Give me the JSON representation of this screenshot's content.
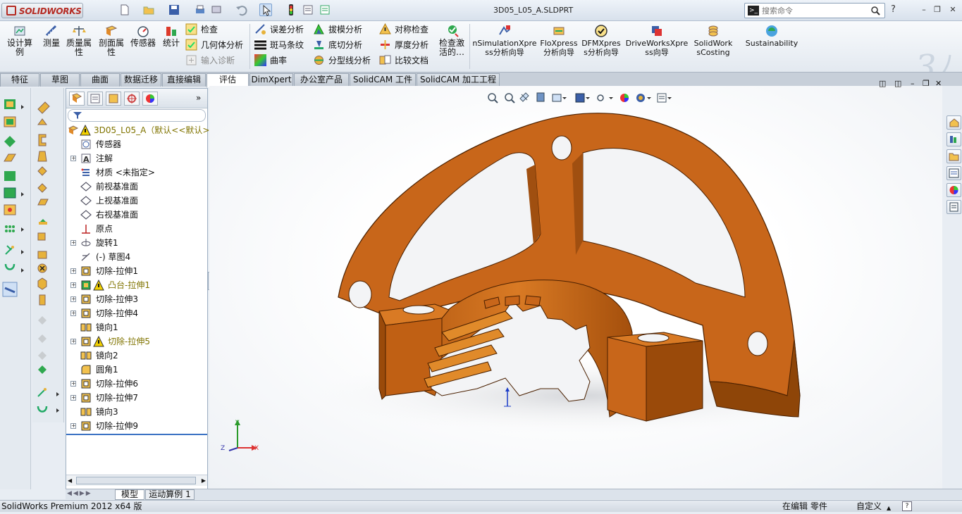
{
  "titlebar": {
    "brand": "SOLIDWORKS",
    "document_title": "3D05_L05_A.SLDPRT",
    "search_placeholder": "搜索命令",
    "help_symbol": "?"
  },
  "command_manager": {
    "big_buttons": [
      {
        "label": "设计算例",
        "icon": "design-study-icon"
      },
      {
        "label": "测量",
        "icon": "measure-icon"
      },
      {
        "label": "质量属性",
        "icon": "mass-properties-icon"
      },
      {
        "label": "剖面属性",
        "icon": "section-properties-icon"
      },
      {
        "label": "传感器",
        "icon": "sensor-icon"
      },
      {
        "label": "统计",
        "icon": "statistics-icon"
      }
    ],
    "col1": [
      {
        "label": "检查",
        "icon": "check-icon",
        "disabled": false
      },
      {
        "label": "几何体分析",
        "icon": "geometry-analysis-icon",
        "disabled": false
      },
      {
        "label": "输入诊断",
        "icon": "import-diagnostics-icon",
        "disabled": true
      }
    ],
    "col2": [
      {
        "label": "误差分析",
        "icon": "deviation-analysis-icon"
      },
      {
        "label": "斑马条纹",
        "icon": "zebra-stripes-icon"
      },
      {
        "label": "曲率",
        "icon": "curvature-icon"
      }
    ],
    "col3": [
      {
        "label": "拔模分析",
        "icon": "draft-analysis-icon"
      },
      {
        "label": "底切分析",
        "icon": "undercut-analysis-icon"
      },
      {
        "label": "分型线分析",
        "icon": "parting-line-analysis-icon"
      }
    ],
    "col4": [
      {
        "label": "对称检查",
        "icon": "symmetry-check-icon"
      },
      {
        "label": "厚度分析",
        "icon": "thickness-analysis-icon"
      },
      {
        "label": "比较文档",
        "icon": "compare-documents-icon"
      }
    ],
    "check_active": "检查激活的…",
    "xpress": [
      {
        "label": "nSimulationXpress分析向导",
        "icon": "simulationxpress-icon"
      },
      {
        "label": "FloXpress分析向导",
        "icon": "floxpress-icon"
      },
      {
        "label": "DFMXpress分析向导",
        "icon": "dfmxpress-icon"
      },
      {
        "label": "DriveWorksXpress向导",
        "icon": "driveworksxpress-icon"
      },
      {
        "label": "SolidWorksCosting",
        "icon": "costing-icon"
      },
      {
        "label": "Sustainability",
        "icon": "sustainability-icon"
      }
    ]
  },
  "tabs": [
    "特征",
    "草图",
    "曲面",
    "数据迁移",
    "直接编辑",
    "评估",
    "DimXpert",
    "办公室产品",
    "SolidCAM 工件",
    "SolidCAM 加工工程"
  ],
  "active_tab": "评估",
  "feature_tree": {
    "root": "3D05_L05_A（默认<<默认>_",
    "items": [
      {
        "label": "传感器",
        "icon": "sensor-folder-icon",
        "expand": false,
        "warn": false
      },
      {
        "label": "注解",
        "icon": "annotations-icon",
        "expand": true,
        "warn": false
      },
      {
        "label": "材质 <未指定>",
        "icon": "material-icon",
        "expand": false,
        "warn": false
      },
      {
        "label": "前视基准面",
        "icon": "plane-icon",
        "expand": false,
        "warn": false
      },
      {
        "label": "上视基准面",
        "icon": "plane-icon",
        "expand": false,
        "warn": false
      },
      {
        "label": "右视基准面",
        "icon": "plane-icon",
        "expand": false,
        "warn": false
      },
      {
        "label": "原点",
        "icon": "origin-icon",
        "expand": false,
        "warn": false
      },
      {
        "label": "旋转1",
        "icon": "revolve-icon",
        "expand": true,
        "warn": false
      },
      {
        "label": "(-) 草图4",
        "icon": "sketch-icon",
        "expand": false,
        "warn": false
      },
      {
        "label": "切除-拉伸1",
        "icon": "cut-extrude-icon",
        "expand": true,
        "warn": false
      },
      {
        "label": "凸台-拉伸1",
        "icon": "boss-extrude-icon",
        "expand": true,
        "warn": true
      },
      {
        "label": "切除-拉伸3",
        "icon": "cut-extrude-icon",
        "expand": true,
        "warn": false
      },
      {
        "label": "切除-拉伸4",
        "icon": "cut-extrude-icon",
        "expand": true,
        "warn": false
      },
      {
        "label": "镜向1",
        "icon": "mirror-icon",
        "expand": false,
        "warn": false
      },
      {
        "label": "切除-拉伸5",
        "icon": "cut-extrude-icon",
        "expand": true,
        "warn": true
      },
      {
        "label": "镜向2",
        "icon": "mirror-icon",
        "expand": false,
        "warn": false
      },
      {
        "label": "圆角1",
        "icon": "fillet-icon",
        "expand": false,
        "warn": false
      },
      {
        "label": "切除-拉伸6",
        "icon": "cut-extrude-icon",
        "expand": true,
        "warn": false
      },
      {
        "label": "切除-拉伸7",
        "icon": "cut-extrude-icon",
        "expand": true,
        "warn": false
      },
      {
        "label": "镜向3",
        "icon": "mirror-icon",
        "expand": false,
        "warn": false
      },
      {
        "label": "切除-拉伸9",
        "icon": "cut-extrude-icon",
        "expand": true,
        "warn": false
      }
    ]
  },
  "bottom_tabs": [
    "模型",
    "运动算例 1"
  ],
  "status": {
    "product": "SolidWorks Premium 2012 x64 版",
    "editing": "在编辑 零件",
    "units": "自定义"
  },
  "triad": {
    "x": "X",
    "y": "Y",
    "z": "Z"
  },
  "colors": {
    "part": "#c8661a",
    "accent": "#3b72c4",
    "warn": "#e0b400"
  }
}
